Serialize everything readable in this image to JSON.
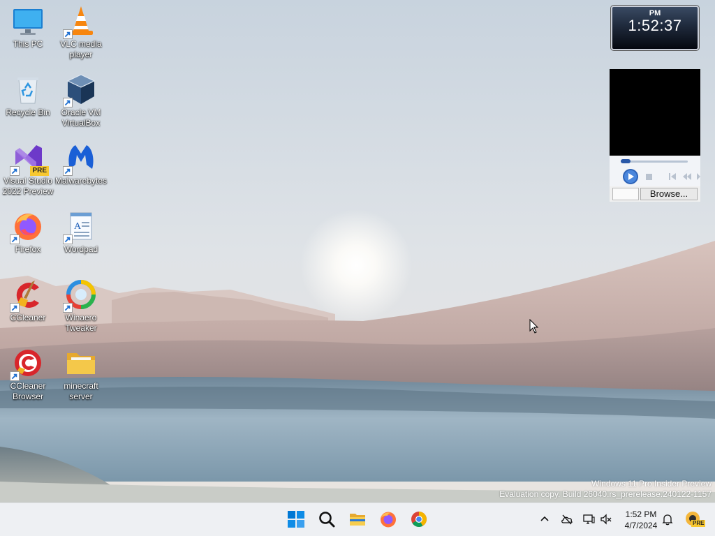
{
  "desktop": {
    "icons": [
      {
        "label": "This PC",
        "icon": "monitor-icon"
      },
      {
        "label": "VLC media player",
        "icon": "vlc-cone-icon"
      },
      {
        "label": "Recycle Bin",
        "icon": "recycle-bin-icon"
      },
      {
        "label": "Oracle VM VirtualBox",
        "icon": "virtualbox-icon"
      },
      {
        "label": "Visual Studio 2022 Preview",
        "icon": "visual-studio-icon",
        "badge": "PRE"
      },
      {
        "label": "Malwarebytes",
        "icon": "malwarebytes-icon"
      },
      {
        "label": "Firefox",
        "icon": "firefox-icon"
      },
      {
        "label": "Wordpad",
        "icon": "wordpad-icon"
      },
      {
        "label": "CCleaner",
        "icon": "ccleaner-icon"
      },
      {
        "label": "Winaero Tweaker",
        "icon": "winaero-icon"
      },
      {
        "label": "CCleaner Browser",
        "icon": "ccleaner-browser-icon"
      },
      {
        "label": "minecraft server",
        "icon": "folder-icon"
      }
    ]
  },
  "clock_gadget": {
    "ampm": "PM",
    "time": "1:52:37"
  },
  "media_gadget": {
    "browse_label": "Browse..."
  },
  "watermark": {
    "line1": "Windows 11 Pro Insider Preview",
    "line2": "Evaluation copy. Build 26040.rs_prerelease.240122-1157"
  },
  "taskbar": {
    "apps": [
      "start-icon",
      "search-icon",
      "file-explorer-icon",
      "firefox-icon",
      "chrome-icon"
    ],
    "tray": {
      "time": "1:52 PM",
      "date": "4/7/2024",
      "badge": "PRE"
    }
  },
  "colors": {
    "taskbar_bg": "#eef0f3",
    "accent_blue": "#0078d4",
    "folder_yellow": "#f4c84a"
  }
}
